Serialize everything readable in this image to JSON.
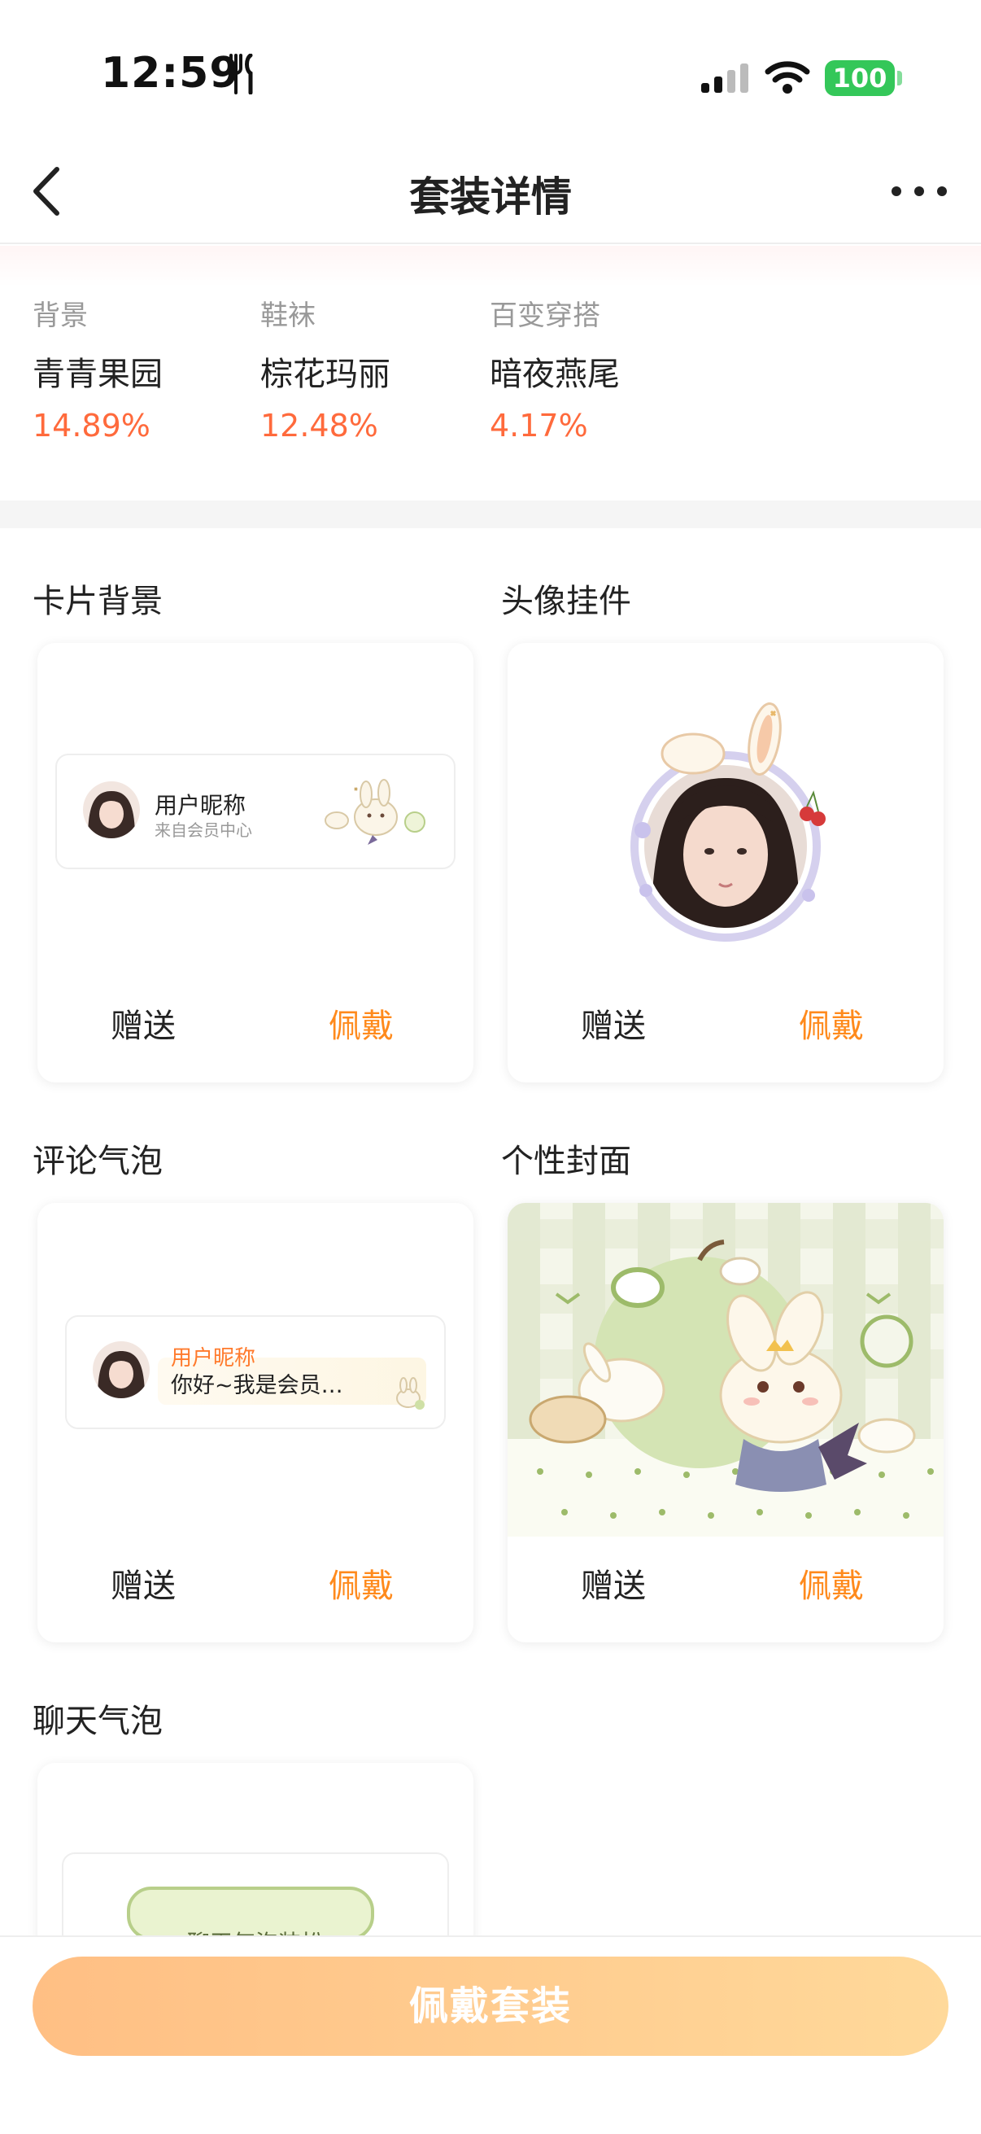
{
  "status_bar": {
    "time": "12:59",
    "battery": "100",
    "icons": [
      "dining-icon",
      "signal-icon",
      "wifi-icon",
      "battery-icon"
    ]
  },
  "nav": {
    "title": "套装详情",
    "back_icon": "chevron-left-icon",
    "more_icon": "more-dots-icon"
  },
  "popularity": [
    {
      "category": "背景",
      "name": "青青果园",
      "percent": "14.89%"
    },
    {
      "category": "鞋袜",
      "name": "棕花玛丽",
      "percent": "12.48%"
    },
    {
      "category": "百变穿搭",
      "name": "暗夜燕尾",
      "percent": "4.17%"
    }
  ],
  "sections": {
    "card_background": {
      "title": "卡片背景",
      "preview_name": "用户昵称",
      "preview_sub": "来自会员中心",
      "gift": "赠送",
      "wear": "佩戴"
    },
    "avatar_pendant": {
      "title": "头像挂件",
      "gift": "赠送",
      "wear": "佩戴"
    },
    "comment_bubble": {
      "title": "评论气泡",
      "preview_name": "用户昵称",
      "preview_text": "你好~我是会员…",
      "gift": "赠送",
      "wear": "佩戴"
    },
    "cover": {
      "title": "个性封面",
      "gift": "赠送",
      "wear": "佩戴"
    },
    "chat_bubble": {
      "title": "聊天气泡",
      "preview_text": "聊天气泡装扮"
    }
  },
  "bottom": {
    "wear_suit": "佩戴套装"
  },
  "colors": {
    "accent_orange": "#ff8a1c",
    "percent_red": "#ff6a3c",
    "button_gradient_start": "#ffbf84",
    "button_gradient_end": "#ffd99a",
    "battery_green": "#34c759"
  }
}
